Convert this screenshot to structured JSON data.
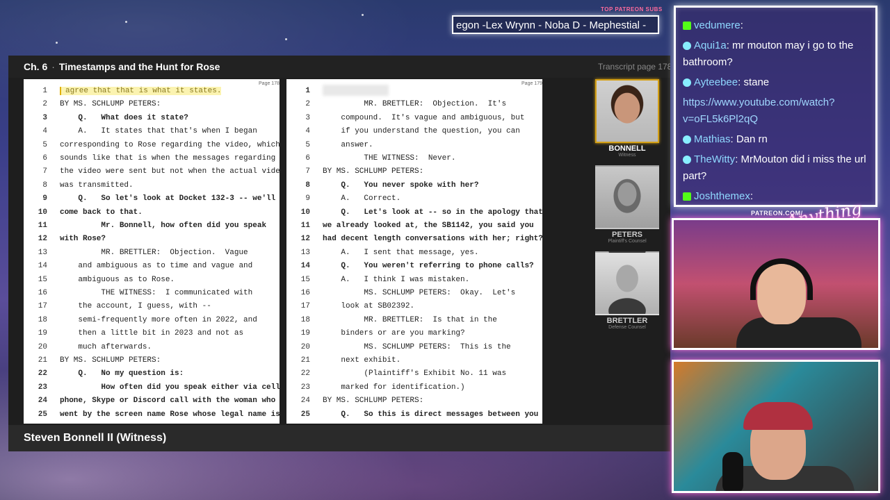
{
  "ticker": {
    "label": "TOP PATREON SUBS",
    "text": "egon -Lex Wrynn -  Noba D - Mephestial -"
  },
  "panel": {
    "chapter_num": "Ch. 6",
    "chapter_title": "Timestamps and the Hunt for Rose",
    "transcript_page": "Transcript page 178",
    "left_page_label": "Page 178",
    "right_page_label": "Page 179"
  },
  "left_page": [
    {
      "n": "1",
      "t": "agree that that is what it states.",
      "hl": true
    },
    {
      "n": "2",
      "t": "BY MS. SCHLUMP PETERS:"
    },
    {
      "n": "3",
      "t": "    Q.   What does it state?",
      "b": true
    },
    {
      "n": "4",
      "t": "    A.   It states that that's when I began"
    },
    {
      "n": "5",
      "t": "corresponding to Rose regarding the video, which"
    },
    {
      "n": "6",
      "t": "sounds like that is when the messages regarding"
    },
    {
      "n": "7",
      "t": "the video were sent but not when the actual video"
    },
    {
      "n": "8",
      "t": "was transmitted."
    },
    {
      "n": "9",
      "t": "    Q.   So let's look at Docket 132-3 -- we'll",
      "b": true
    },
    {
      "n": "10",
      "t": "come back to that.",
      "b": true
    },
    {
      "n": "11",
      "t": "         Mr. Bonnell, how often did you speak",
      "b": true
    },
    {
      "n": "12",
      "t": "with Rose?",
      "b": true
    },
    {
      "n": "13",
      "t": "         MR. BRETTLER:  Objection.  Vague"
    },
    {
      "n": "14",
      "t": "    and ambiguous as to time and vague and"
    },
    {
      "n": "15",
      "t": "    ambiguous as to Rose."
    },
    {
      "n": "16",
      "t": "         THE WITNESS:  I communicated with"
    },
    {
      "n": "17",
      "t": "    the account, I guess, with --"
    },
    {
      "n": "18",
      "t": "    semi-frequently more often in 2022, and"
    },
    {
      "n": "19",
      "t": "    then a little bit in 2023 and not as"
    },
    {
      "n": "20",
      "t": "    much afterwards."
    },
    {
      "n": "21",
      "t": "BY MS. SCHLUMP PETERS:"
    },
    {
      "n": "22",
      "t": "    Q.   No my question is:",
      "b": true
    },
    {
      "n": "23",
      "t": "         How often did you speak either via cell",
      "b": true
    },
    {
      "n": "24",
      "t": "phone, Skype or Discord call with the woman who",
      "b": true
    },
    {
      "n": "25",
      "t": "went by the screen name Rose whose legal name is",
      "b": true
    }
  ],
  "right_page": [
    {
      "n": "1",
      "t": "",
      "redact": true,
      "b": true
    },
    {
      "n": "2",
      "t": "         MR. BRETTLER:  Objection.  It's"
    },
    {
      "n": "3",
      "t": "    compound.  It's vague and ambiguous, but"
    },
    {
      "n": "4",
      "t": "    if you understand the question, you can"
    },
    {
      "n": "5",
      "t": "    answer."
    },
    {
      "n": "6",
      "t": "         THE WITNESS:  Never."
    },
    {
      "n": "7",
      "t": "BY MS. SCHLUMP PETERS:"
    },
    {
      "n": "8",
      "t": "    Q.   You never spoke with her?",
      "b": true
    },
    {
      "n": "9",
      "t": "    A.   Correct."
    },
    {
      "n": "10",
      "t": "    Q.   Let's look at -- so in the apology that",
      "b": true
    },
    {
      "n": "11",
      "t": "we already looked at, the SB1142, you said you",
      "b": true
    },
    {
      "n": "12",
      "t": "had decent length conversations with her; right?",
      "b": true
    },
    {
      "n": "13",
      "t": "    A.   I sent that message, yes."
    },
    {
      "n": "14",
      "t": "    Q.   You weren't referring to phone calls?",
      "b": true
    },
    {
      "n": "15",
      "t": "    A.   I think I was mistaken."
    },
    {
      "n": "16",
      "t": "         MS. SCHLUMP PETERS:  Okay.  Let's"
    },
    {
      "n": "17",
      "t": "    look at SB02392."
    },
    {
      "n": "18",
      "t": "         MR. BRETTLER:  Is that in the"
    },
    {
      "n": "19",
      "t": "    binders or are you marking?"
    },
    {
      "n": "20",
      "t": "         MS. SCHLUMP PETERS:  This is the"
    },
    {
      "n": "21",
      "t": "    next exhibit."
    },
    {
      "n": "22",
      "t": "         (Plaintiff's Exhibit No. 11 was"
    },
    {
      "n": "23",
      "t": "    marked for identification.)"
    },
    {
      "n": "24",
      "t": "BY MS. SCHLUMP PETERS:"
    },
    {
      "n": "25",
      "t": "    Q.   So this is direct messages between you",
      "b": true
    }
  ],
  "speakers": [
    {
      "name": "BONNELL",
      "role": "Witness",
      "active": true
    },
    {
      "name": "PETERS",
      "role": "Plaintiff's Counsel",
      "active": false
    },
    {
      "name": "BRETTLER",
      "role": "Defense Counsel",
      "active": false
    }
  ],
  "caption": "Steven Bonnell II (Witness)",
  "chat": {
    "messages": [
      {
        "user": "vedumere",
        "text": ":",
        "color": "#53fc18",
        "badge": "sq"
      },
      {
        "user": "Aqui1a",
        "text": ": mr mouton may i go to the bathroom?",
        "color": "#53fc18"
      },
      {
        "user": "Ayteebee",
        "text": ": stane",
        "color": "#53fc18"
      },
      {
        "user": "",
        "text": "https://www.youtube.com/watch?v=oFL5k6Pl2qQ",
        "link": true
      },
      {
        "user": "Mathias",
        "text": ": Dan rn",
        "color": "#53fc18"
      },
      {
        "user": "TheWitty",
        "text": ": MrMouton did i miss the url part?",
        "color": "#53fc18"
      },
      {
        "user": "Joshthemex",
        "text": ":",
        "color": "#53fc18",
        "badge": "sq"
      }
    ]
  },
  "patreon_label": "PATREON.COM/",
  "signature": "Anything Goes"
}
